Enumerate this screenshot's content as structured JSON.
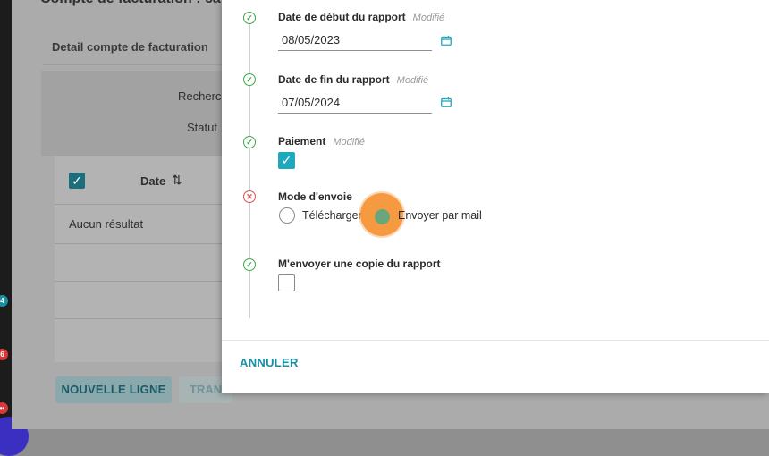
{
  "background": {
    "header_title": "Compte de facturation : carte",
    "tab_label": "Detail compte de facturation",
    "filters": [
      "Recherche",
      "Statut"
    ],
    "table": {
      "column_date": "Date",
      "empty_message": "Aucun résultat"
    },
    "buttons": {
      "new_line": "NOUVELLE LIGNE",
      "second": "TRAN"
    },
    "strip_badges": [
      "4",
      "6",
      "••"
    ]
  },
  "dialog": {
    "steps": [
      {
        "label": "Date de début du rapport",
        "status": "Modifié",
        "value": "08/05/2023",
        "state": "ok"
      },
      {
        "label": "Date de fin du rapport",
        "status": "Modifié",
        "value": "07/05/2024",
        "state": "ok"
      },
      {
        "label": "Paiement",
        "status": "Modifié",
        "checked": true,
        "state": "ok"
      },
      {
        "label": "Mode d'envoie",
        "state": "error",
        "options": [
          "Télécharger",
          "Envoyer par mail"
        ],
        "selected": "Envoyer par mail"
      },
      {
        "label": "M'envoyer une copie du rapport",
        "checked": false,
        "state": "ok"
      }
    ],
    "cancel_label": "ANNULER"
  },
  "colors": {
    "accent": "#1fa9be",
    "ok": "#3fa64a",
    "error": "#d9534f",
    "click_indicator": "#f58c28"
  }
}
